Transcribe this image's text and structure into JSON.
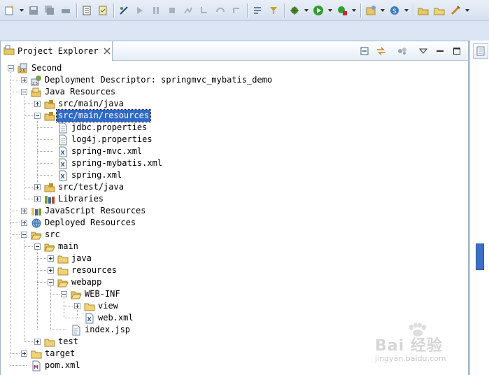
{
  "view": {
    "title": "Project Explorer"
  },
  "colors": {
    "selection": "#3169c6",
    "toolbar": "#d6e0ef"
  },
  "tree": [
    {
      "label": "Second",
      "icon": "project-icon",
      "expander": "minus"
    },
    {
      "label": "Deployment Descriptor: springmvc_mybatis_demo",
      "icon": "deployment-descriptor-icon",
      "expander": "plus"
    },
    {
      "label": "Java Resources",
      "icon": "java-resources-icon",
      "expander": "minus"
    },
    {
      "label": "src/main/java",
      "icon": "source-folder-icon",
      "expander": "plus"
    },
    {
      "label": "src/main/resources",
      "icon": "source-folder-icon",
      "expander": "minus",
      "selected": true
    },
    {
      "label": "jdbc.properties",
      "icon": "properties-file-icon",
      "expander": "none"
    },
    {
      "label": "log4j.properties",
      "icon": "properties-file-icon",
      "expander": "none"
    },
    {
      "label": "spring-mvc.xml",
      "icon": "xml-file-icon",
      "expander": "none"
    },
    {
      "label": "spring-mybatis.xml",
      "icon": "xml-file-icon",
      "expander": "none"
    },
    {
      "label": "spring.xml",
      "icon": "xml-file-icon",
      "expander": "none"
    },
    {
      "label": "src/test/java",
      "icon": "source-folder-icon",
      "expander": "plus"
    },
    {
      "label": "Libraries",
      "icon": "libraries-icon",
      "expander": "plus"
    },
    {
      "label": "JavaScript Resources",
      "icon": "javascript-resources-icon",
      "expander": "plus"
    },
    {
      "label": "Deployed Resources",
      "icon": "deployed-resources-icon",
      "expander": "plus"
    },
    {
      "label": "src",
      "icon": "folder-open-icon",
      "expander": "minus"
    },
    {
      "label": "main",
      "icon": "folder-open-icon",
      "expander": "minus"
    },
    {
      "label": "java",
      "icon": "folder-icon",
      "expander": "plus"
    },
    {
      "label": "resources",
      "icon": "folder-icon",
      "expander": "plus"
    },
    {
      "label": "webapp",
      "icon": "folder-open-icon",
      "expander": "minus"
    },
    {
      "label": "WEB-INF",
      "icon": "folder-open-icon",
      "expander": "minus"
    },
    {
      "label": "view",
      "icon": "folder-icon",
      "expander": "plus"
    },
    {
      "label": "web.xml",
      "icon": "xml-file-icon",
      "expander": "none"
    },
    {
      "label": "index.jsp",
      "icon": "jsp-file-icon",
      "expander": "none"
    },
    {
      "label": "test",
      "icon": "folder-icon",
      "expander": "plus"
    },
    {
      "label": "target",
      "icon": "folder-icon",
      "expander": "plus"
    },
    {
      "label": "pom.xml",
      "icon": "maven-pom-icon",
      "expander": "none"
    }
  ],
  "watermark": {
    "logo": "Bai 经验",
    "url": "jingyan.baidu.com"
  }
}
